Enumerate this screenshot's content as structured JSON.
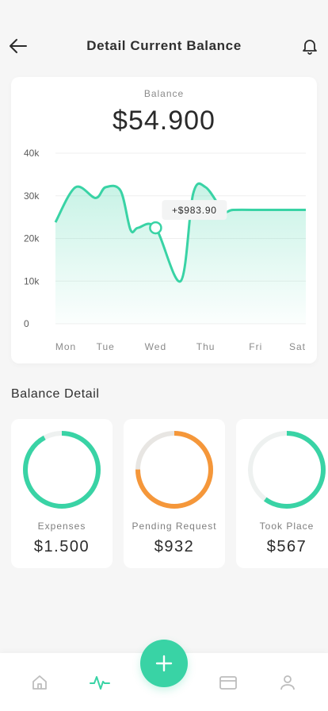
{
  "header": {
    "title": "Detail Current Balance",
    "back_icon": "arrow-left-icon",
    "notification_icon": "bell-icon"
  },
  "balance": {
    "label": "Balance",
    "amount": "$54.900"
  },
  "chart_data": {
    "type": "area",
    "categories": [
      "Mon",
      "Tue",
      "Wed",
      "Thu",
      "Fri",
      "Sat"
    ],
    "y_ticks": [
      "40k",
      "30k",
      "20k",
      "10k",
      "0"
    ],
    "ylim": [
      0,
      40000
    ],
    "grid": true,
    "color": "#39d3a5",
    "series": [
      {
        "x": [
          0,
          0.4,
          0.8,
          1.0,
          1.3,
          1.5,
          1.65,
          2.0,
          2.5,
          2.75,
          3.0,
          3.35,
          3.55,
          4.1,
          4.35,
          4.65,
          5.0
        ],
        "values": [
          23800,
          32000,
          29500,
          32000,
          31200,
          22000,
          22500,
          22500,
          10000,
          30500,
          32000,
          26500,
          26700,
          26700,
          26700,
          26700,
          26700
        ]
      }
    ],
    "highlight": {
      "category": "Wed",
      "label": "+$983.90"
    }
  },
  "balance_detail": {
    "title": "Balance Detail",
    "cards": [
      {
        "label": "Expenses",
        "amount": "$1.500",
        "progress": 0.92,
        "color": "#39d3a5"
      },
      {
        "label": "Pending Request",
        "amount": "$932",
        "progress": 0.75,
        "color": "#f5973a"
      },
      {
        "label": "Took Place",
        "amount": "$567",
        "progress": 0.6,
        "color": "#39d3a5"
      }
    ]
  },
  "nav": {
    "items": [
      "home-icon",
      "activity-icon",
      "card-icon",
      "user-icon"
    ],
    "active": "activity-icon",
    "fab_icon": "plus-icon",
    "active_color": "#39d3a5",
    "inactive_color": "#bdbdbd"
  }
}
